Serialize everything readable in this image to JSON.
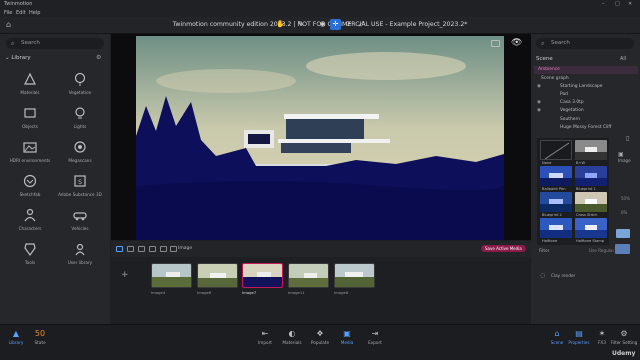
{
  "window": {
    "app_name": "Twinmotion",
    "title": "Twinmotion community edition 2023.2 | NOT FOR COMMERCIAL USE - Example Project_2023.2*"
  },
  "menu": [
    "File",
    "Edit",
    "Help"
  ],
  "left": {
    "search_placeholder": "Search",
    "library_label": "Library",
    "items": [
      "Materials",
      "Vegetation",
      "Objects",
      "Lights",
      "HDRI environments",
      "Megascans",
      "Sketchfab",
      "Adobe Substance 3D",
      "Characters",
      "Vehicles",
      "Tools",
      "User library"
    ]
  },
  "right": {
    "search_placeholder": "Search",
    "scene_label": "Scene",
    "scene_filter": "All",
    "scene_rows": [
      "Ambience",
      "Scene graph",
      "Starting Landscape",
      "Pad",
      "Casa 3.0tp",
      "Vegetation",
      "Southern",
      "Huge Mossy Forest Cliff"
    ],
    "styles": [
      "None",
      "B+W",
      "Ballpoint Pen",
      "Blueprint 1",
      "Blueprint 2",
      "Cross Stitch",
      "Halftone",
      "Halftone Stamp"
    ],
    "side_label": "Image",
    "vals": [
      "50%",
      "0%"
    ],
    "filter_label": "Filter",
    "filter_value": "Use Regular",
    "clay_label": "Clay render"
  },
  "timeline": {
    "section_label": "Image",
    "save_button": "Save Active Media",
    "thumbs": [
      "Image4",
      "Image6",
      "Image7",
      "Image11",
      "Image8"
    ]
  },
  "bottom": {
    "library": "Library",
    "state_value": "50",
    "state_label": "State",
    "nav": [
      "Import",
      "Materials",
      "Populate",
      "Media",
      "Export"
    ],
    "right_nav": [
      "Scene",
      "Properties",
      "FX3",
      "Filter Setting"
    ],
    "udemy": "Udemy"
  },
  "colors": {
    "accent": "#2b6fd6",
    "selection": "#c2185b",
    "panel": "#26272b"
  }
}
